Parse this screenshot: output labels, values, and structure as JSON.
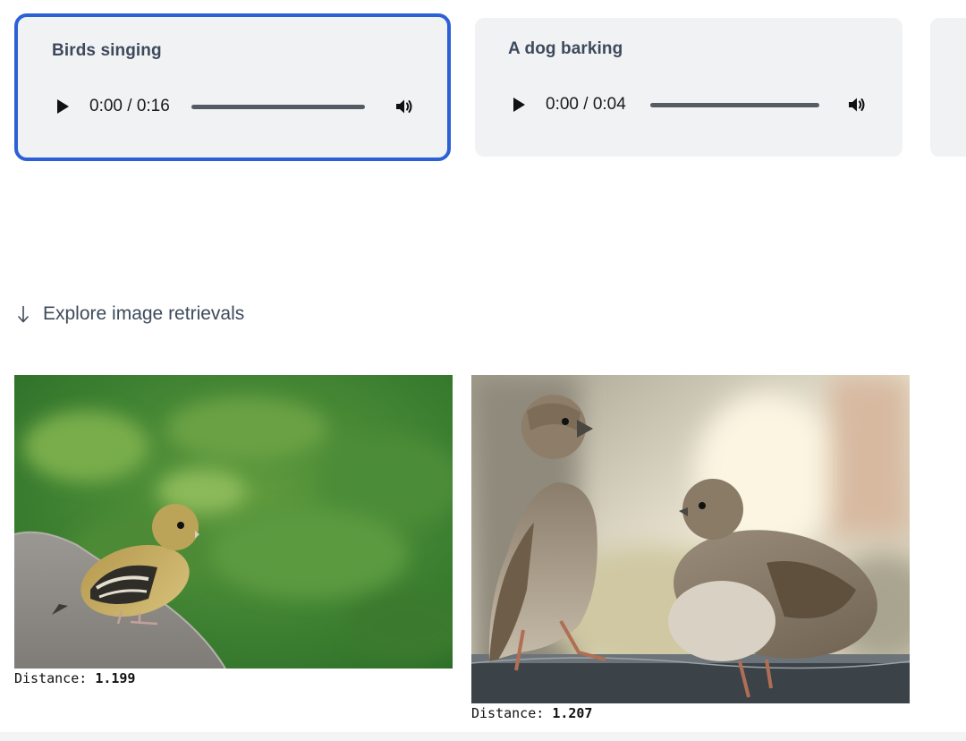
{
  "audio_cards": [
    {
      "title": "Birds singing",
      "time": "0:00 / 0:16",
      "selected": true
    },
    {
      "title": "A dog barking",
      "time": "0:00 / 0:04",
      "selected": false
    },
    {
      "title": "",
      "time": "",
      "selected": false
    }
  ],
  "explore": {
    "label": "Explore image retrievals",
    "icon": "arrow-down-icon"
  },
  "results": [
    {
      "distance_label": "Distance:",
      "distance_value": "1.199"
    },
    {
      "distance_label": "Distance:",
      "distance_value": "1.207"
    }
  ],
  "colors": {
    "selected_border": "#2c60d6",
    "card_bg": "#f1f2f4",
    "title_text": "#3e4a5b"
  }
}
